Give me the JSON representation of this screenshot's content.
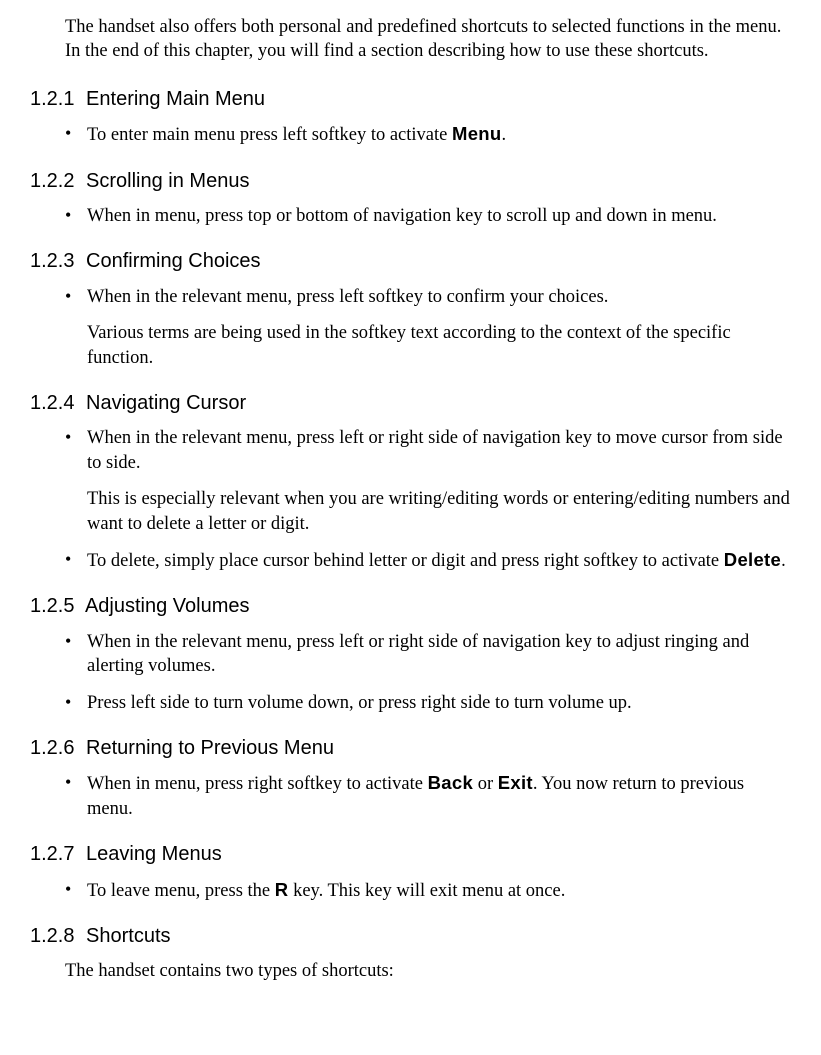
{
  "intro": "The handset also offers both personal and predefined shortcuts to selected functions in the menu. In the end of this chapter, you will find a section describing how to use these shortcuts.",
  "sections": {
    "s1": {
      "num": "1.2.1",
      "title": "Entering Main Menu",
      "b1a": "To enter main menu press left softkey to activate ",
      "b1kw": "Menu",
      "b1b": "."
    },
    "s2": {
      "num": "1.2.2",
      "title": "Scrolling in Menus",
      "b1": "When in menu, press top or bottom of navigation key to scroll up and down in menu."
    },
    "s3": {
      "num": "1.2.3",
      "title": "Confirming Choices",
      "b1": "When in the relevant menu, press left softkey to confirm your choices.",
      "p1": "Various terms are being used in the softkey text according to the context of the specific function."
    },
    "s4": {
      "num": "1.2.4",
      "title": "Navigating Cursor",
      "b1": "When in the relevant menu, press left or right side of navigation key to move cursor from side to side.",
      "p1": "This is especially relevant when you are writing/editing words or entering/editing numbers and want to delete a letter or digit.",
      "b2a": "To delete, simply place cursor behind letter or digit and press right softkey to activate ",
      "b2kw": "Delete",
      "b2b": "."
    },
    "s5": {
      "num": "1.2.5",
      "title": "Adjusting Volumes",
      "b1": "When in the relevant menu, press left or right side of navigation key to adjust ringing and alerting volumes.",
      "b2": "Press left side to turn volume down, or press right side to turn volume up."
    },
    "s6": {
      "num": "1.2.6",
      "title": "Returning to Previous Menu",
      "b1a": "When in menu, press right softkey to activate ",
      "b1kw1": "Back",
      "b1mid": " or ",
      "b1kw2": "Exit",
      "b1b": ". You now return to previous menu."
    },
    "s7": {
      "num": "1.2.7",
      "title": "Leaving Menus",
      "b1a": "To leave menu, press the ",
      "b1kw": "R",
      "b1b": " key. This key will exit menu at once."
    },
    "s8": {
      "num": "1.2.8",
      "title": "Shortcuts",
      "p1": "The handset contains two types of shortcuts:"
    }
  }
}
